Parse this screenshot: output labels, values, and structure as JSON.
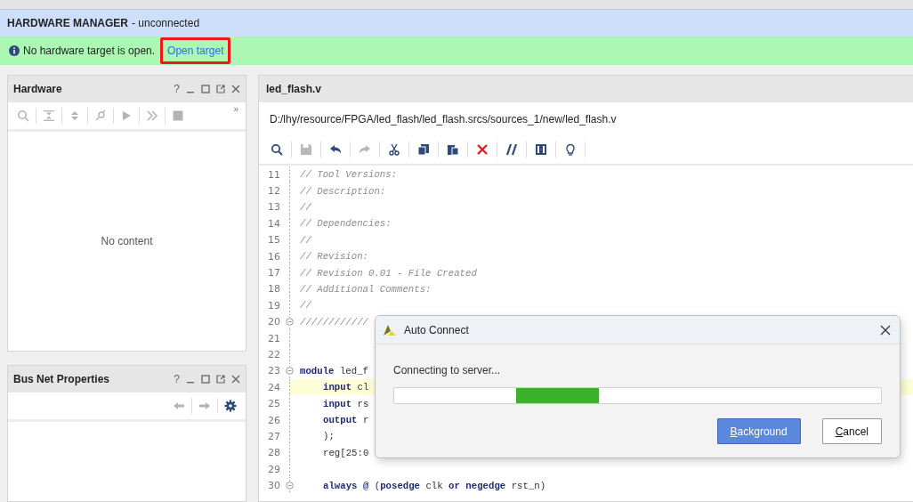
{
  "header": {
    "title": "HARDWARE MANAGER",
    "status": "- unconnected"
  },
  "banner": {
    "message": "No hardware target is open.",
    "link": "Open target",
    "link_marked": true
  },
  "panels": [
    {
      "title": "Hardware",
      "help": "?",
      "toolbar": [
        {
          "kind": "search",
          "disabled": true
        },
        {
          "kind": "collapse",
          "disabled": true
        },
        {
          "kind": "expand",
          "disabled": true
        },
        {
          "kind": "connect",
          "disabled": true
        },
        {
          "kind": "play",
          "disabled": true
        },
        {
          "kind": "fastforward",
          "disabled": true
        },
        {
          "kind": "stop",
          "disabled": true
        }
      ],
      "overflow": "»",
      "empty_text": "No content"
    },
    {
      "title": "Bus Net Properties",
      "help": "?",
      "toolbar": [
        {
          "kind": "back",
          "disabled": true
        },
        {
          "kind": "forward",
          "disabled": true
        },
        {
          "kind": "gear",
          "disabled": false
        }
      ]
    }
  ],
  "editor": {
    "tab": "led_flash.v",
    "path": "D:/lhy/resource/FPGA/led_flash/led_flash.srcs/sources_1/new/led_flash.v",
    "toolbar": [
      {
        "kind": "search",
        "disabled": false
      },
      {
        "kind": "save",
        "disabled": true
      },
      {
        "kind": "undo",
        "disabled": false
      },
      {
        "kind": "redo",
        "disabled": true
      },
      {
        "kind": "cut",
        "disabled": false
      },
      {
        "kind": "copy",
        "disabled": false
      },
      {
        "kind": "paste",
        "disabled": false
      },
      {
        "kind": "delete",
        "disabled": false
      },
      {
        "kind": "comment",
        "disabled": false
      },
      {
        "kind": "columns",
        "disabled": false
      },
      {
        "kind": "bulb",
        "disabled": false
      }
    ],
    "lines": [
      {
        "number": "11",
        "fold": false,
        "indented": false,
        "highlighted": false,
        "tokens": [
          {
            "kind": "comment",
            "text": "// Tool Versions:"
          }
        ]
      },
      {
        "number": "12",
        "fold": false,
        "indented": false,
        "highlighted": false,
        "tokens": [
          {
            "kind": "comment",
            "text": "// Description:"
          }
        ]
      },
      {
        "number": "13",
        "fold": false,
        "indented": false,
        "highlighted": false,
        "tokens": [
          {
            "kind": "comment",
            "text": "//"
          }
        ]
      },
      {
        "number": "14",
        "fold": false,
        "indented": false,
        "highlighted": false,
        "tokens": [
          {
            "kind": "comment",
            "text": "// Dependencies:"
          }
        ]
      },
      {
        "number": "15",
        "fold": false,
        "indented": false,
        "highlighted": false,
        "tokens": [
          {
            "kind": "comment",
            "text": "//"
          }
        ]
      },
      {
        "number": "16",
        "fold": false,
        "indented": false,
        "highlighted": false,
        "tokens": [
          {
            "kind": "comment",
            "text": "// Revision:"
          }
        ]
      },
      {
        "number": "17",
        "fold": false,
        "indented": false,
        "highlighted": false,
        "tokens": [
          {
            "kind": "comment",
            "text": "// Revision 0.01 - File Created"
          }
        ]
      },
      {
        "number": "18",
        "fold": false,
        "indented": false,
        "highlighted": false,
        "tokens": [
          {
            "kind": "comment",
            "text": "// Additional Comments:"
          }
        ]
      },
      {
        "number": "19",
        "fold": false,
        "indented": false,
        "highlighted": false,
        "tokens": [
          {
            "kind": "comment",
            "text": "//"
          }
        ]
      },
      {
        "number": "20",
        "fold": true,
        "indented": false,
        "highlighted": false,
        "tokens": [
          {
            "kind": "comment",
            "text": "////////////"
          }
        ]
      },
      {
        "number": "21",
        "fold": false,
        "highlighted": false
      },
      {
        "number": "22",
        "fold": false,
        "highlighted": false
      },
      {
        "number": "23",
        "fold": true,
        "indented": false,
        "highlighted": false,
        "tokens": [
          {
            "kind": "keyword",
            "text": "module"
          },
          {
            "kind": "plain",
            "text": "led_f"
          }
        ]
      },
      {
        "number": "24",
        "fold": false,
        "indented": true,
        "highlighted": true,
        "tokens": [
          {
            "kind": "keyword",
            "text": "input"
          },
          {
            "kind": "plain",
            "text": "cl"
          }
        ]
      },
      {
        "number": "25",
        "fold": false,
        "indented": true,
        "highlighted": false,
        "tokens": [
          {
            "kind": "keyword",
            "text": "input"
          },
          {
            "kind": "plain",
            "text": "rs"
          }
        ]
      },
      {
        "number": "26",
        "fold": false,
        "indented": true,
        "highlighted": false,
        "tokens": [
          {
            "kind": "keyword",
            "text": "output"
          },
          {
            "kind": "plain",
            "text": "r"
          }
        ]
      },
      {
        "number": "27",
        "fold": false,
        "indented": true,
        "highlighted": false,
        "tokens": [
          {
            "kind": "plain",
            "text": ");"
          }
        ]
      },
      {
        "number": "28",
        "fold": false,
        "indented": true,
        "highlighted": false,
        "tokens": [
          {
            "kind": "plain",
            "text": "reg[25:0"
          }
        ]
      },
      {
        "number": "29",
        "fold": false,
        "highlighted": false
      },
      {
        "number": "30",
        "fold": true,
        "indented": true,
        "highlighted": false,
        "tokens": [
          {
            "kind": "keyword",
            "text": "always"
          },
          {
            "kind": "keyword",
            "text": "@"
          },
          {
            "kind": "plain",
            "text": "(",
            "tight": true
          },
          {
            "kind": "keyword",
            "text": "posedge"
          },
          {
            "kind": "plain",
            "text": "clk"
          },
          {
            "kind": "keyword",
            "text": "or"
          },
          {
            "kind": "keyword",
            "text": "negedge"
          },
          {
            "kind": "plain",
            "text": "rst_n)"
          }
        ]
      }
    ]
  },
  "dialog": {
    "title": "Auto Connect",
    "message": "Connecting to server...",
    "progress": {
      "indeterminate": true
    },
    "buttons": [
      {
        "label": "Background",
        "primary": true
      },
      {
        "label": "Cancel",
        "primary": false
      }
    ]
  }
}
